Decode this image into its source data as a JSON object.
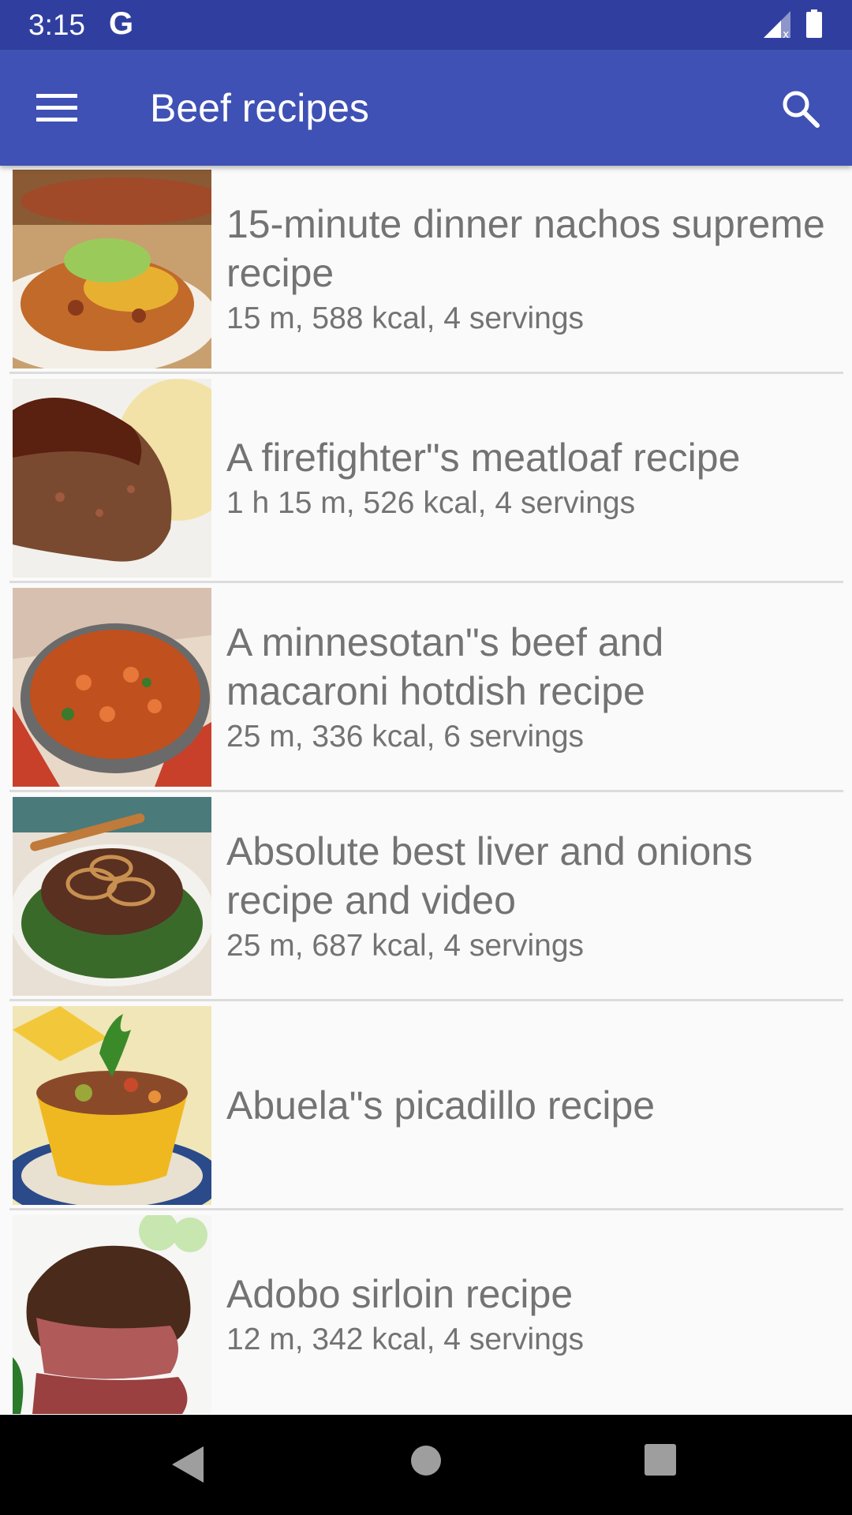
{
  "status_bar": {
    "time": "3:15",
    "carrier_icon": "G",
    "icons": [
      "signal-icon",
      "battery-icon"
    ]
  },
  "app_bar": {
    "title": "Beef recipes",
    "left_icon": "menu-icon",
    "right_icon": "search-icon",
    "color": "#3f51b5",
    "status_color": "#303f9f"
  },
  "recipes": [
    {
      "title": "15-minute dinner nachos supreme recipe",
      "meta": "15 m, 588 kcal, 4 servings",
      "image": "nachos-photo"
    },
    {
      "title": "A firefighter\"s meatloaf recipe",
      "meta": "1 h 15 m, 526 kcal, 4 servings",
      "image": "meatloaf-photo"
    },
    {
      "title": "A minnesotan\"s beef and macaroni hotdish recipe",
      "meta": "25 m, 336 kcal, 6 servings",
      "image": "macaroni-photo"
    },
    {
      "title": "Absolute best liver and onions recipe and video",
      "meta": "25 m, 687 kcal, 4 servings",
      "image": "liver-onions-photo"
    },
    {
      "title": "Abuela\"s picadillo recipe",
      "meta": "",
      "image": "picadillo-photo"
    },
    {
      "title": "Adobo sirloin recipe",
      "meta": "12 m, 342 kcal, 4 servings",
      "image": "sirloin-photo"
    }
  ],
  "nav_bar": {
    "icons": [
      "back-icon",
      "home-icon",
      "recents-icon"
    ]
  }
}
